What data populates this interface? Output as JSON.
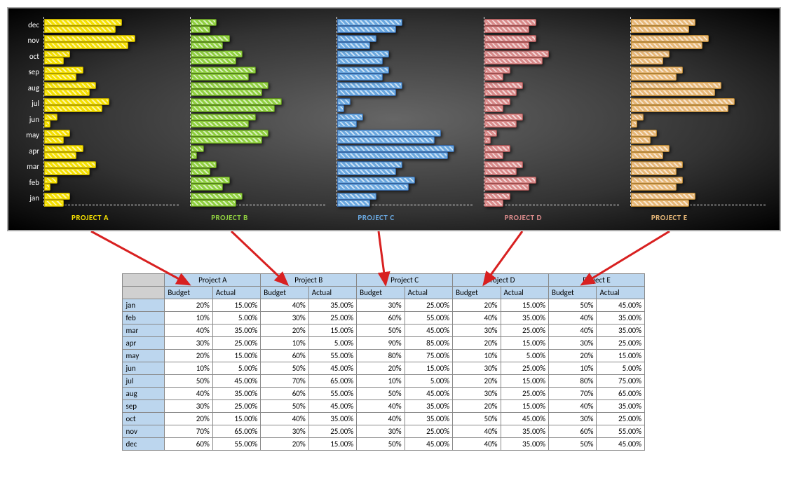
{
  "months": [
    "jan",
    "feb",
    "mar",
    "apr",
    "may",
    "jun",
    "jul",
    "aug",
    "sep",
    "oct",
    "nov",
    "dec"
  ],
  "projects": [
    {
      "key": "A",
      "name": "Project A",
      "label": "PROJECT A",
      "color": "#f5e000"
    },
    {
      "key": "B",
      "name": "Project B",
      "label": "PROJECT B",
      "color": "#90d040"
    },
    {
      "key": "C",
      "name": "Project C",
      "label": "PROJECT C",
      "color": "#6aa8e0"
    },
    {
      "key": "D",
      "name": "Project D",
      "label": "PROJECT D",
      "color": "#d98a8a"
    },
    {
      "key": "E",
      "name": "Project E",
      "label": "PROJECT E",
      "color": "#e8b878"
    }
  ],
  "columns": [
    "Budget",
    "Actual"
  ],
  "table": {
    "A": {
      "budget": [
        20,
        10,
        40,
        30,
        20,
        10,
        50,
        40,
        30,
        20,
        70,
        60
      ],
      "actual": [
        15,
        5,
        35,
        25,
        15,
        5,
        45,
        35,
        25,
        15,
        65,
        55
      ]
    },
    "B": {
      "budget": [
        40,
        30,
        20,
        10,
        60,
        50,
        70,
        60,
        50,
        40,
        30,
        20
      ],
      "actual": [
        35,
        25,
        15,
        5,
        55,
        45,
        65,
        55,
        45,
        35,
        25,
        15
      ]
    },
    "C": {
      "budget": [
        30,
        60,
        50,
        90,
        80,
        20,
        10,
        50,
        40,
        40,
        30,
        50
      ],
      "actual": [
        25,
        55,
        45,
        85,
        75,
        15,
        5,
        45,
        35,
        35,
        25,
        45
      ]
    },
    "D": {
      "budget": [
        20,
        40,
        30,
        20,
        10,
        30,
        20,
        30,
        20,
        50,
        40,
        40
      ],
      "actual": [
        15,
        35,
        25,
        15,
        5,
        25,
        15,
        25,
        15,
        45,
        35,
        35
      ]
    },
    "E": {
      "budget": [
        50,
        40,
        40,
        30,
        20,
        10,
        80,
        70,
        40,
        30,
        60,
        50
      ],
      "actual": [
        45,
        35,
        35,
        25,
        15,
        5,
        75,
        65,
        35,
        25,
        55,
        45
      ]
    }
  },
  "budget_suffix": "%",
  "actual_suffix": ".00%",
  "chart_data": [
    {
      "project": "A",
      "type": "bar",
      "orientation": "horizontal",
      "categories": [
        "jan",
        "feb",
        "mar",
        "apr",
        "may",
        "jun",
        "jul",
        "aug",
        "sep",
        "oct",
        "nov",
        "dec"
      ],
      "series": [
        {
          "name": "Budget",
          "values": [
            20,
            10,
            40,
            30,
            20,
            10,
            50,
            40,
            30,
            20,
            70,
            60
          ]
        },
        {
          "name": "Actual",
          "values": [
            15,
            5,
            35,
            25,
            15,
            5,
            45,
            35,
            25,
            15,
            65,
            55
          ]
        }
      ],
      "xlim": [
        0,
        100
      ],
      "xlabel": "",
      "ylabel": "",
      "title": "PROJECT A"
    },
    {
      "project": "B",
      "type": "bar",
      "orientation": "horizontal",
      "categories": [
        "jan",
        "feb",
        "mar",
        "apr",
        "may",
        "jun",
        "jul",
        "aug",
        "sep",
        "oct",
        "nov",
        "dec"
      ],
      "series": [
        {
          "name": "Budget",
          "values": [
            40,
            30,
            20,
            10,
            60,
            50,
            70,
            60,
            50,
            40,
            30,
            20
          ]
        },
        {
          "name": "Actual",
          "values": [
            35,
            25,
            15,
            5,
            55,
            45,
            65,
            55,
            45,
            35,
            25,
            15
          ]
        }
      ],
      "xlim": [
        0,
        100
      ],
      "xlabel": "",
      "ylabel": "",
      "title": "PROJECT B"
    },
    {
      "project": "C",
      "type": "bar",
      "orientation": "horizontal",
      "categories": [
        "jan",
        "feb",
        "mar",
        "apr",
        "may",
        "jun",
        "jul",
        "aug",
        "sep",
        "oct",
        "nov",
        "dec"
      ],
      "series": [
        {
          "name": "Budget",
          "values": [
            30,
            60,
            50,
            90,
            80,
            20,
            10,
            50,
            40,
            40,
            30,
            50
          ]
        },
        {
          "name": "Actual",
          "values": [
            25,
            55,
            45,
            85,
            75,
            15,
            5,
            45,
            35,
            35,
            25,
            45
          ]
        }
      ],
      "xlim": [
        0,
        100
      ],
      "xlabel": "",
      "ylabel": "",
      "title": "PROJECT C"
    },
    {
      "project": "D",
      "type": "bar",
      "orientation": "horizontal",
      "categories": [
        "jan",
        "feb",
        "mar",
        "apr",
        "may",
        "jun",
        "jul",
        "aug",
        "sep",
        "oct",
        "nov",
        "dec"
      ],
      "series": [
        {
          "name": "Budget",
          "values": [
            20,
            40,
            30,
            20,
            10,
            30,
            20,
            30,
            20,
            50,
            40,
            40
          ]
        },
        {
          "name": "Actual",
          "values": [
            15,
            35,
            25,
            15,
            5,
            25,
            15,
            25,
            15,
            45,
            35,
            35
          ]
        }
      ],
      "xlim": [
        0,
        100
      ],
      "xlabel": "",
      "ylabel": "",
      "title": "PROJECT D"
    },
    {
      "project": "E",
      "type": "bar",
      "orientation": "horizontal",
      "categories": [
        "jan",
        "feb",
        "mar",
        "apr",
        "may",
        "jun",
        "jul",
        "aug",
        "sep",
        "oct",
        "nov",
        "dec"
      ],
      "series": [
        {
          "name": "Budget",
          "values": [
            50,
            40,
            40,
            30,
            20,
            10,
            80,
            70,
            40,
            30,
            60,
            50
          ]
        },
        {
          "name": "Actual",
          "values": [
            45,
            35,
            35,
            25,
            15,
            5,
            75,
            65,
            35,
            25,
            55,
            45
          ]
        }
      ],
      "xlim": [
        0,
        100
      ],
      "xlabel": "",
      "ylabel": "",
      "title": "PROJECT E"
    }
  ]
}
